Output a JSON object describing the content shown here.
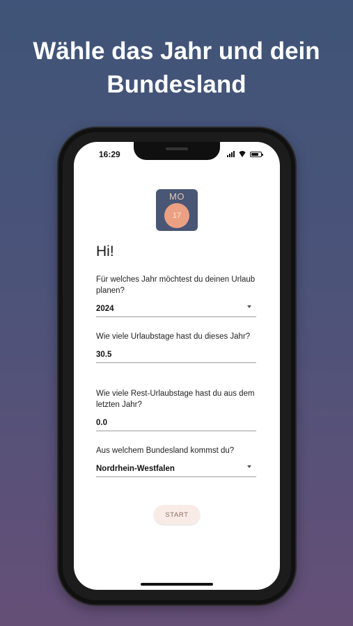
{
  "headline": {
    "line1": "Wähle das Jahr und dein",
    "line2": "Bundesland"
  },
  "status_bar": {
    "time": "16:29",
    "icons": [
      "signal-icon",
      "wifi-icon",
      "battery-icon"
    ]
  },
  "app_icon": {
    "day": "MO",
    "date": "17"
  },
  "greeting": "Hi!",
  "form": {
    "year": {
      "label": "Für welches Jahr möchtest du deinen Urlaub planen?",
      "value": "2024"
    },
    "vacation_days": {
      "label": "Wie viele Urlaubstage hast du dieses Jahr?",
      "value": "30.5"
    },
    "remaining_days": {
      "label": "Wie viele Rest-Urlaubstage hast du aus dem letzten Jahr?",
      "value": "0.0"
    },
    "state": {
      "label": "Aus welchem Bundesland kommst du?",
      "value": "Nordrhein-Westfalen"
    },
    "start_label": "START"
  },
  "colors": {
    "background_top": "#3f5478",
    "background_bottom": "#654f77",
    "app_icon_bg": "#495675",
    "app_icon_circle": "#eba083",
    "start_button_bg": "#f9ece6"
  }
}
